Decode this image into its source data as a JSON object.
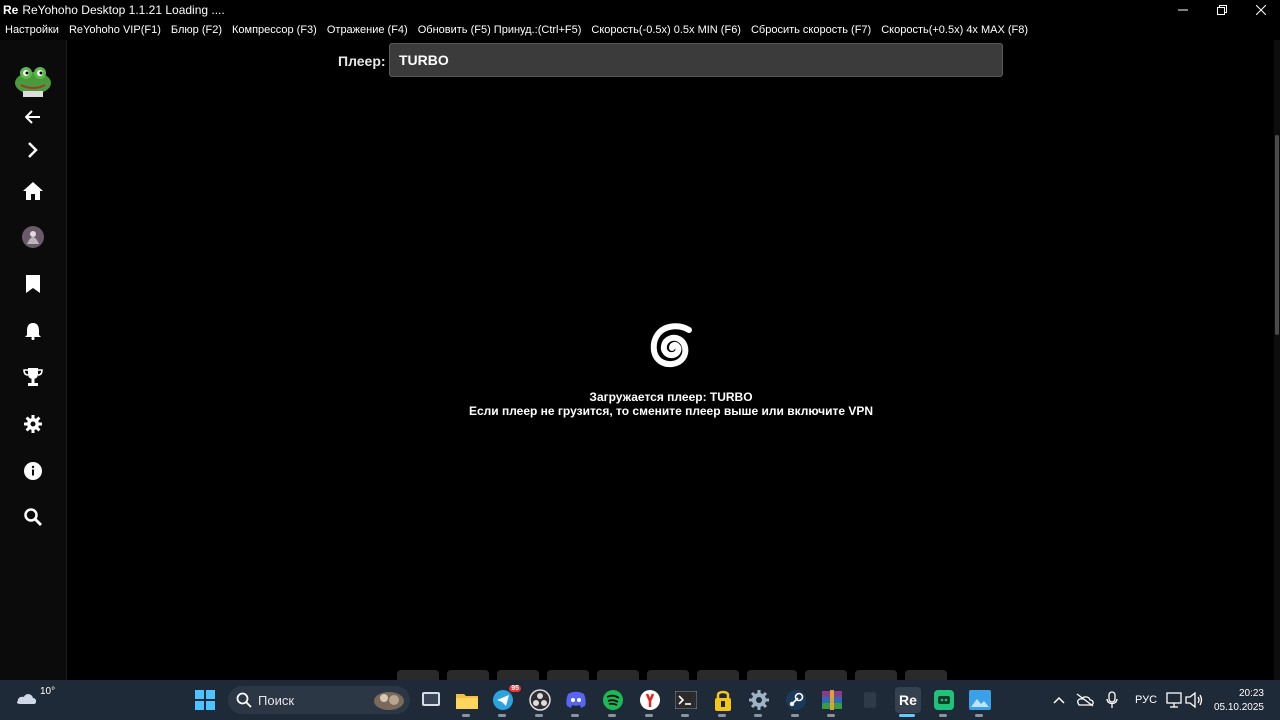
{
  "window": {
    "app_badge": "Re",
    "title": "ReYohoho Desktop 1.1.21 Loading ....",
    "controls": [
      "minimize-icon",
      "restore-icon",
      "close-icon"
    ]
  },
  "menu": {
    "items": [
      "Настройки",
      "ReYohoho VIP(F1)",
      "Блюр (F2)",
      "Компрессор (F3)",
      "Отражение (F4)",
      "Обновить (F5) Принуд.:(Ctrl+F5)",
      "Скорость(-0.5x) 0.5x MIN (F6)",
      "Сбросить скорость (F7)",
      "Скорость(+0.5x) 4x MAX (F8)"
    ]
  },
  "sidebar": {
    "icons": [
      "logo-icon",
      "back-arrow-icon",
      "forward-chevron-icon",
      "home-icon",
      "avatar-icon",
      "bookmark-icon",
      "bell-icon",
      "trophy-icon",
      "gear-icon",
      "info-icon",
      "search-icon"
    ]
  },
  "player": {
    "label": "Плеер:",
    "value": "TURBO"
  },
  "loading": {
    "line1": "Загружается плеер: TURBO",
    "line2": "Если плеер не грузится, то смените плеер выше или включите VPN"
  },
  "taskbar": {
    "weather_temp": "10°",
    "search_placeholder": "Поиск",
    "telegram_badge": "95",
    "active_app_label": "Re",
    "language": "РУС",
    "time": "20:23",
    "date": "05.10.2025"
  },
  "colors": {
    "background": "#000000",
    "field_bg": "#3b3b3b",
    "taskbar_bg": "#1f2a38",
    "accent": "#60cdff"
  }
}
